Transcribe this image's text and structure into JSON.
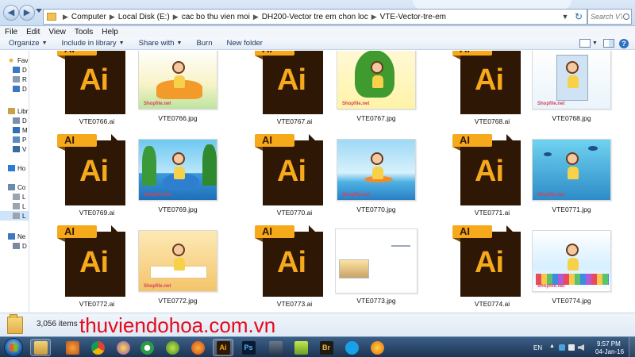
{
  "address_bar": {
    "crumbs": [
      "Computer",
      "Local Disk (E:)",
      "cac bo thu vien moi",
      "DH200-Vector tre em chon loc",
      "VTE-Vector-tre-em"
    ]
  },
  "search": {
    "placeholder": "Search VTE-Vector-tre-em"
  },
  "menu": [
    "File",
    "Edit",
    "View",
    "Tools",
    "Help"
  ],
  "commands": {
    "organize": "Organize",
    "include_in_library": "Include in library",
    "share_with": "Share with",
    "burn": "Burn",
    "new_folder": "New folder"
  },
  "nav_pane": {
    "items": [
      {
        "label": "Fav",
        "icon": "star-icon"
      },
      {
        "label": "D",
        "icon": "desktop-icon"
      },
      {
        "label": "R",
        "icon": "recent-places-icon"
      },
      {
        "label": "D",
        "icon": "downloads-icon"
      },
      {
        "label": "Libr",
        "icon": "libraries-icon"
      },
      {
        "label": "D",
        "icon": "documents-icon"
      },
      {
        "label": "M",
        "icon": "music-icon"
      },
      {
        "label": "P",
        "icon": "pictures-icon"
      },
      {
        "label": "V",
        "icon": "videos-icon"
      },
      {
        "label": "Ho",
        "icon": "homegroup-icon"
      },
      {
        "label": "Co",
        "icon": "computer-icon"
      },
      {
        "label": "L",
        "icon": "drive-icon"
      },
      {
        "label": "L",
        "icon": "drive-icon"
      },
      {
        "label": "L",
        "icon": "drive-icon"
      },
      {
        "label": "Ne",
        "icon": "network-icon"
      },
      {
        "label": "D",
        "icon": "network-computer-icon"
      }
    ]
  },
  "files": [
    {
      "name": "VTE0766.ai",
      "kind": "ai"
    },
    {
      "name": "VTE0766.jpg",
      "kind": "jpg",
      "theme": "car"
    },
    {
      "name": "VTE0767.ai",
      "kind": "ai"
    },
    {
      "name": "VTE0767.jpg",
      "kind": "jpg",
      "theme": "tree"
    },
    {
      "name": "VTE0768.ai",
      "kind": "ai"
    },
    {
      "name": "VTE0768.jpg",
      "kind": "jpg",
      "theme": "fridge"
    },
    {
      "name": "VTE0769.ai",
      "kind": "ai"
    },
    {
      "name": "VTE0769.jpg",
      "kind": "jpg",
      "theme": "whale"
    },
    {
      "name": "VTE0770.ai",
      "kind": "ai"
    },
    {
      "name": "VTE0770.jpg",
      "kind": "jpg",
      "theme": "surf"
    },
    {
      "name": "VTE0771.ai",
      "kind": "ai"
    },
    {
      "name": "VTE0771.jpg",
      "kind": "jpg",
      "theme": "underwater"
    },
    {
      "name": "VTE0772.ai",
      "kind": "ai"
    },
    {
      "name": "VTE0772.jpg",
      "kind": "jpg",
      "theme": "autumn"
    },
    {
      "name": "VTE0773.ai",
      "kind": "ai"
    },
    {
      "name": "VTE0773.jpg",
      "kind": "jpg",
      "theme": "small"
    },
    {
      "name": "VTE0774.ai",
      "kind": "ai"
    },
    {
      "name": "VTE0774.jpg",
      "kind": "jpg",
      "theme": "crayons"
    }
  ],
  "ai_icon": {
    "tab_text": "AI",
    "big_text": "Ai"
  },
  "thumbnail_watermark": "Shopfile.net",
  "details_pane": {
    "item_count": "3,056 items",
    "brand": "thuviendohoa.com.vn"
  },
  "taskbar": {
    "apps": [
      {
        "icon": "windows-explorer-icon",
        "active": true
      },
      {
        "icon": "media-player-icon",
        "active": false
      },
      {
        "icon": "chrome-icon",
        "active": false
      },
      {
        "icon": "yahoo-messenger-icon",
        "active": false
      },
      {
        "icon": "app-green-icon",
        "active": false
      },
      {
        "icon": "corel-icon",
        "active": false
      },
      {
        "icon": "firefox-icon",
        "active": false
      },
      {
        "icon": "illustrator-icon",
        "label": "Ai",
        "active": true
      },
      {
        "icon": "photoshop-icon",
        "label": "Ps",
        "active": false
      },
      {
        "icon": "app-x-icon",
        "active": false
      },
      {
        "icon": "app-lime-icon",
        "active": false
      },
      {
        "icon": "bridge-icon",
        "label": "Br",
        "active": false
      },
      {
        "icon": "skype-icon",
        "active": false
      },
      {
        "icon": "app-orange-icon",
        "active": false
      }
    ],
    "lang": "EN",
    "time": "9:57 PM",
    "date": "04-Jan-16"
  },
  "colors": {
    "ai_orange": "#f6a91a",
    "ai_brown": "#2e1704",
    "brand_red": "#e30b1c",
    "taskbar_blue": "#1c3554"
  }
}
